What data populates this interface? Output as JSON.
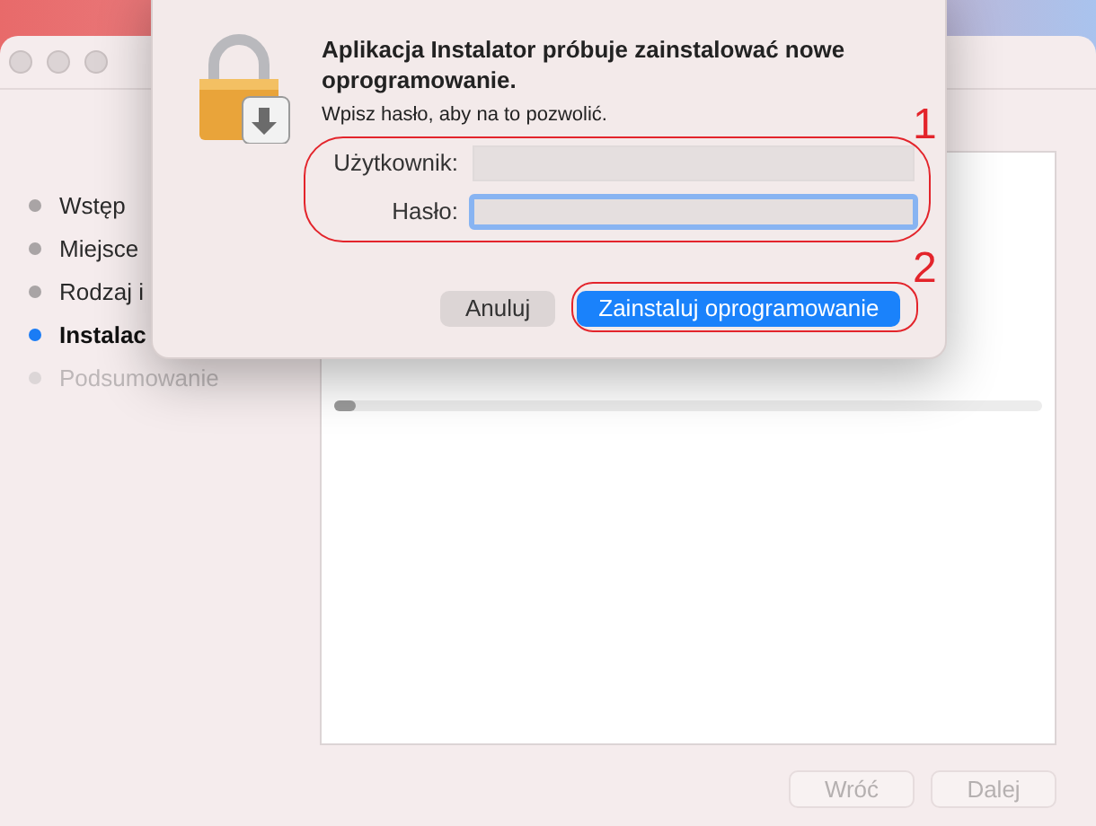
{
  "steps": [
    {
      "label": "Wstęp",
      "selected": false,
      "completed": true
    },
    {
      "label": "Miejsce",
      "selected": false,
      "completed": true
    },
    {
      "label": "Rodzaj i",
      "selected": false,
      "completed": true
    },
    {
      "label": "Instalac",
      "selected": true,
      "completed": false
    },
    {
      "label": "Podsumowanie",
      "selected": false,
      "completed": false
    }
  ],
  "progress": {
    "level": 0.03
  },
  "footer_buttons": [
    {
      "label": "Wróć",
      "disabled": true
    },
    {
      "label": "Dalej",
      "disabled": true
    }
  ],
  "dialog": {
    "title": "Aplikacja Instalator próbuje zainstalować nowe oprogramowanie.",
    "message": "Wpisz hasło, aby na to pozwolić.",
    "fields": [
      {
        "label": "Użytkownik:",
        "focused": false
      },
      {
        "label": "Hasło:",
        "focused": true
      }
    ],
    "buttons": [
      {
        "label": "Anuluj",
        "default": false
      },
      {
        "label": "Zainstaluj oprogramowanie",
        "default": true
      }
    ]
  },
  "annotations": [
    {
      "label": "1"
    },
    {
      "label": "2"
    }
  ]
}
